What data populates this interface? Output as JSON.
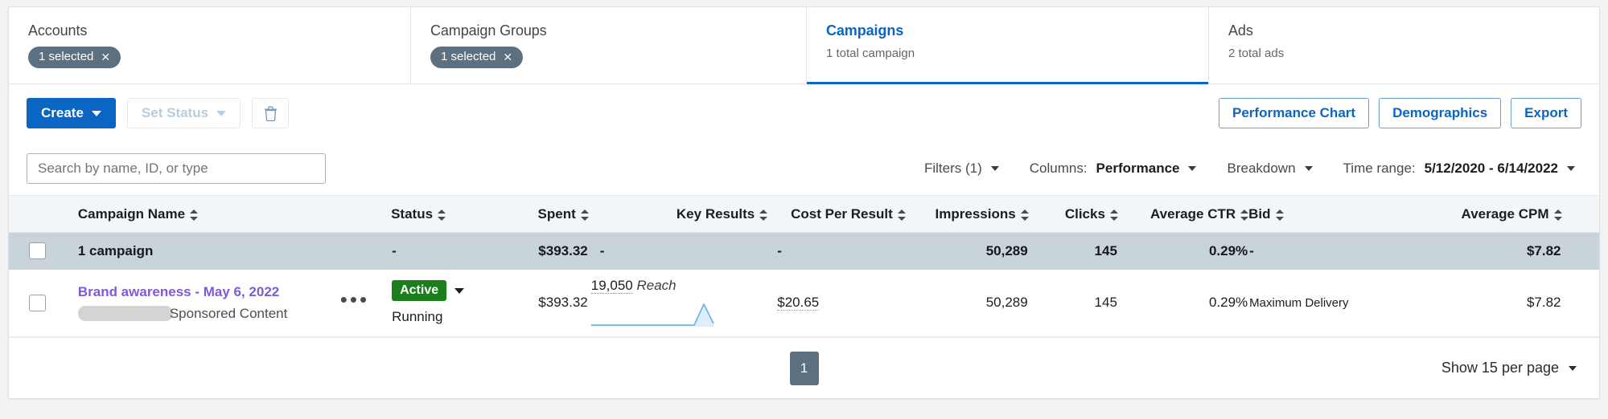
{
  "scope_tabs": [
    {
      "title": "Accounts",
      "pill": "1 selected",
      "pill_close": "✕",
      "active": false
    },
    {
      "title": "Campaign Groups",
      "pill": "1 selected",
      "pill_close": "✕",
      "active": false
    },
    {
      "title": "Campaigns",
      "subtitle": "1 total campaign",
      "active": true
    },
    {
      "title": "Ads",
      "subtitle": "2 total ads",
      "active": false
    }
  ],
  "toolbar": {
    "create_label": "Create",
    "set_status_label": "Set Status",
    "delete_icon": "trash-icon",
    "performance_chart_label": "Performance Chart",
    "demographics_label": "Demographics",
    "export_label": "Export"
  },
  "filters": {
    "search_placeholder": "Search by name, ID, or type",
    "search_value": "",
    "filters_label": "Filters (1)",
    "columns_label": "Columns:",
    "columns_value": "Performance",
    "breakdown_label": "Breakdown",
    "time_range_label": "Time range:",
    "time_range_value": "5/12/2020 - 6/14/2022"
  },
  "table": {
    "headers": [
      "Campaign Name",
      "Status",
      "Spent",
      "Key Results",
      "Cost Per Result",
      "Impressions",
      "Clicks",
      "Average CTR",
      "Bid",
      "Average CPM"
    ],
    "summary": {
      "name": "1 campaign",
      "status": "-",
      "spent": "$393.32",
      "key_results": "-",
      "cost_per_result": "-",
      "impressions": "50,289",
      "clicks": "145",
      "average_ctr": "0.29%",
      "bid": "-",
      "average_cpm": "$7.82"
    },
    "rows": [
      {
        "name": "Brand awareness - May 6, 2022",
        "type": "Sponsored Content",
        "overflow_icon": "•••",
        "status_badge": "Active",
        "status_detail": "Running",
        "spent": "$393.32",
        "key_results_value": "19,050",
        "key_results_unit": "Reach",
        "cost_per_result": "$20.65",
        "impressions": "50,289",
        "clicks": "145",
        "average_ctr": "0.29%",
        "bid": "Maximum Delivery",
        "average_cpm": "$7.82"
      }
    ]
  },
  "footer": {
    "current_page": "1",
    "per_page_label": "Show 15 per page"
  },
  "colors": {
    "brand_blue": "#0a66c2",
    "pill_slate": "#5c7080",
    "active_green": "#1a7f1a",
    "link_purple": "#7b5bd6",
    "summary_bg": "#c9d4da",
    "spark_line": "#71b7e6"
  },
  "sparkline": {
    "type": "line",
    "values": [
      0,
      0,
      0,
      0,
      0,
      0,
      0,
      0,
      0,
      0,
      0,
      0,
      0,
      0,
      0,
      0,
      0,
      0,
      0,
      0,
      0,
      0,
      0,
      0,
      0,
      0,
      0,
      1,
      0.12
    ],
    "ylim": [
      0,
      1
    ]
  }
}
